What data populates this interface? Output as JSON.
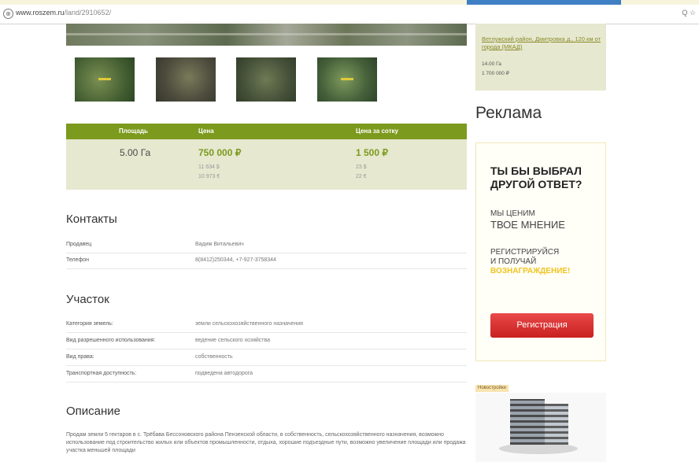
{
  "browser": {
    "url_host": "www.roszem.ru",
    "url_path": "/land/2910652/",
    "tools": "Q ☆"
  },
  "price_table": {
    "headers": [
      "Площадь",
      "Цена",
      "Цена за сотку"
    ],
    "area": "5.00 Га",
    "price": "750 000 ₽",
    "price_per_sotka": "1 500 ₽",
    "price_sub1": "11 634 $",
    "price_sub2": "10 973 €",
    "sotka_sub1": "23 $",
    "sotka_sub2": "22 €"
  },
  "contacts": {
    "title": "Контакты",
    "rows": [
      {
        "key": "Продавец",
        "value": "Вадим Витальевич"
      },
      {
        "key": "Телефон",
        "value": "8(8412)250344, +7-927-3758344"
      }
    ]
  },
  "plot": {
    "title": "Участок",
    "rows": [
      {
        "key": "Категория земель:",
        "value": "земли сельскохозяйственного назначения"
      },
      {
        "key": "Вид разрешенного использования:",
        "value": "ведение сельского хозяйства"
      },
      {
        "key": "Вид права:",
        "value": "собственность"
      },
      {
        "key": "Транспортная доступность:",
        "value": "подведена автодорога"
      }
    ]
  },
  "description": {
    "title": "Описание",
    "text": "Продам земли 5 гектаров в с. Трёбава Бессоновского района Пензенской области, в собственность, сельскохозяйственного назначения, возможно использование под строительство жилых или объектов промышленности, отдыха, хорошие подъездные пути, возможно увеличение площади или продажа участка меньшей площади"
  },
  "sidebar": {
    "link": "Ветлужский район, Дмитровка д., 120 км от города (МКАД)",
    "area": "14.00 Га",
    "price": "1 700 000 ₽",
    "ad_heading": "Реклама",
    "ad": {
      "question": "ТЫ БЫ ВЫБРАЛ ДРУГОЙ ОТВЕТ?",
      "line1": "МЫ ЦЕНИМ",
      "line2": "ТВОЕ МНЕНИЕ",
      "line3": "РЕГИСТРИРУЙСЯ",
      "line4": "И ПОЛУЧАЙ",
      "line5": "ВОЗНАГРАЖДЕНИЕ!",
      "button": "Регистрация"
    },
    "partner_label": "Новостройки"
  }
}
